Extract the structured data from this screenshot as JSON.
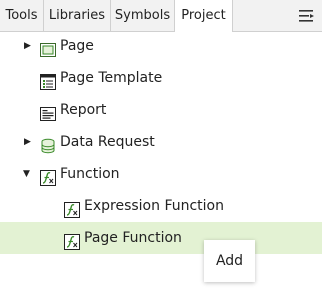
{
  "tabs": [
    {
      "label": "Tools"
    },
    {
      "label": "Libraries"
    },
    {
      "label": "Symbols"
    },
    {
      "label": "Project",
      "active": true
    }
  ],
  "panel_menu_icon": "list-menu-icon",
  "tree": {
    "items": [
      {
        "label": "Page",
        "icon": "page-icon",
        "expander": "collapsed"
      },
      {
        "label": "Page Template",
        "icon": "page-template-icon",
        "expander": "none"
      },
      {
        "label": "Report",
        "icon": "report-icon",
        "expander": "none"
      },
      {
        "label": "Data Request",
        "icon": "database-icon",
        "expander": "collapsed"
      },
      {
        "label": "Function",
        "icon": "function-icon",
        "expander": "expanded"
      },
      {
        "label": "Expression Function",
        "icon": "function-icon",
        "expander": "none"
      },
      {
        "label": "Page Function",
        "icon": "function-icon",
        "expander": "none",
        "selected": true
      }
    ]
  },
  "context_menu": {
    "items": [
      "Add"
    ]
  },
  "colors": {
    "selection": "#e3f2d3",
    "icon_green": "#3a8a2a",
    "tab_bg": "#f2f2f2"
  }
}
